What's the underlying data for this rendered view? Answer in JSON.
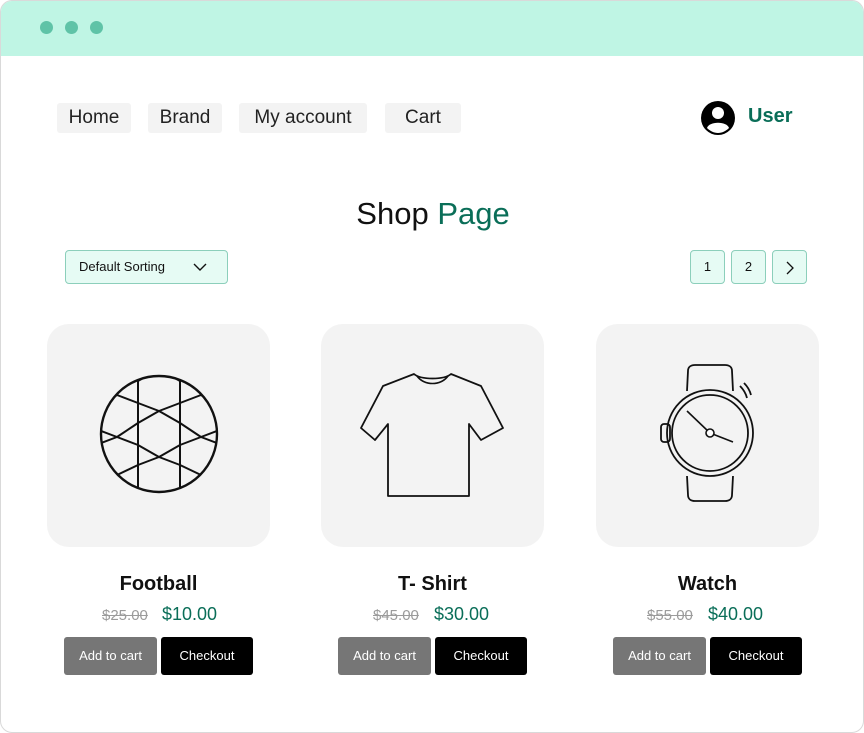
{
  "nav": {
    "items": [
      {
        "label": "Home"
      },
      {
        "label": "Brand"
      },
      {
        "label": "My account"
      },
      {
        "label": "Cart"
      }
    ],
    "user_label": "User",
    "user_icon": "user-circle-icon"
  },
  "page": {
    "title_part1": "Shop",
    "title_part2": "Page"
  },
  "sorting": {
    "selected": "Default Sorting",
    "icon": "chevron-down-icon"
  },
  "pagination": {
    "pages": [
      "1",
      "2"
    ],
    "next_icon": "chevron-right-icon"
  },
  "products": [
    {
      "name": "Football",
      "old_price": "$25.00",
      "new_price": "$10.00",
      "add_label": "Add to cart",
      "checkout_label": "Checkout",
      "icon": "football-icon"
    },
    {
      "name": "T- Shirt",
      "old_price": "$45.00",
      "new_price": "$30.00",
      "add_label": "Add to cart",
      "checkout_label": "Checkout",
      "icon": "tshirt-icon"
    },
    {
      "name": "Watch",
      "old_price": "$55.00",
      "new_price": "$40.00",
      "add_label": "Add to cart",
      "checkout_label": "Checkout",
      "icon": "watch-icon"
    }
  ],
  "colors": {
    "titlebar": "#bff5e4",
    "accent": "#0a6e58",
    "control_bg": "#e6fbf4",
    "card_bg": "#f3f3f3"
  }
}
